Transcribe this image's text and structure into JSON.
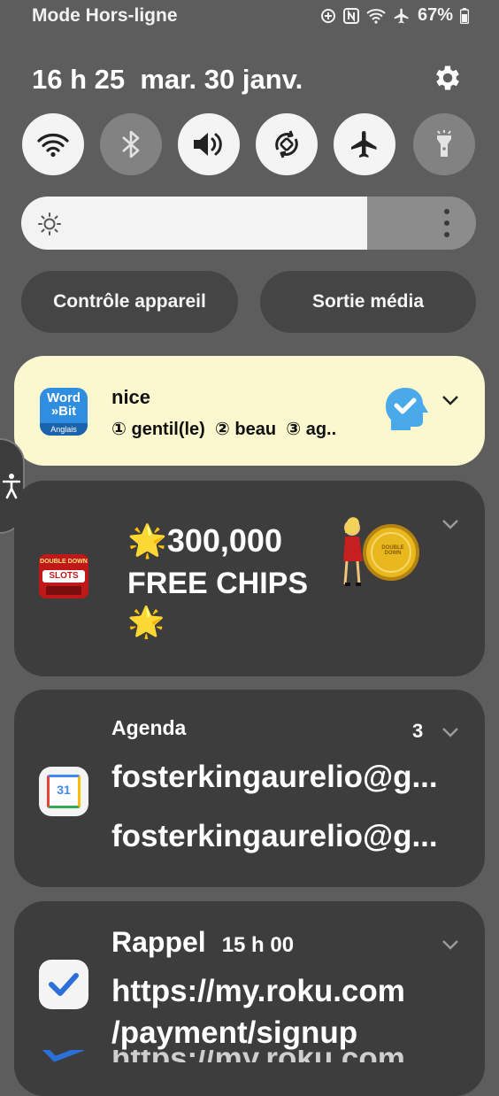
{
  "status_bar": {
    "carrier_text": "Mode Hors-ligne",
    "battery": "67%"
  },
  "header": {
    "time": "16 h 25",
    "date": "mar. 30 janv."
  },
  "quick_settings": {
    "toggles": [
      {
        "name": "wifi",
        "on": true
      },
      {
        "name": "bluetooth",
        "on": false
      },
      {
        "name": "sound",
        "on": true
      },
      {
        "name": "auto-rotate",
        "on": true
      },
      {
        "name": "airplane-mode",
        "on": true
      },
      {
        "name": "flashlight",
        "on": false
      }
    ],
    "brightness_level": 0.76,
    "device_control_label": "Contrôle appareil",
    "media_output_label": "Sortie média"
  },
  "notifications": {
    "wordbit": {
      "app_logo_line1": "Word",
      "app_logo_line2": "»Bit",
      "app_logo_line3": "Anglais",
      "title": "nice",
      "body": "① gentil(le)  ② beau  ③ ag.."
    },
    "doubledown": {
      "logo_top": "DOUBLE DOWN",
      "logo_bottom": "SLOTS",
      "line1": "300,000",
      "line2": "FREE CHIPS",
      "star": "🌟",
      "coin_text": "DOUBLE DOWN"
    },
    "agenda": {
      "app_name": "Agenda",
      "count": "3",
      "icon_text": "31",
      "line1": "fosterkingaurelio@g...",
      "line2": "fosterkingaurelio@g..."
    },
    "reminder": {
      "title": "Rappel",
      "time": "15 h 00",
      "line1": "https://my.roku.com",
      "line2": "/payment/signup",
      "line3": "https://my.roku.com"
    }
  },
  "colors": {
    "background": "#5d5d5d",
    "card_dark": "#3d3d3d",
    "card_highlight": "#fbf7cf",
    "toggle_on": "#f4f4f4",
    "toggle_off": "#828282"
  }
}
